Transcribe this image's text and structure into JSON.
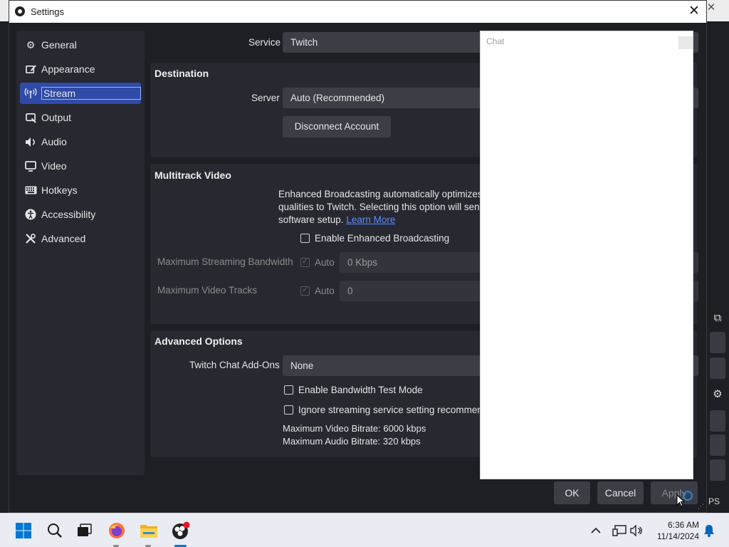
{
  "window": {
    "title": "Settings"
  },
  "sidebar": {
    "items": [
      {
        "label": "General",
        "icon": "gear-icon"
      },
      {
        "label": "Appearance",
        "icon": "brush-icon"
      },
      {
        "label": "Stream",
        "icon": "broadcast-icon",
        "active": true
      },
      {
        "label": "Output",
        "icon": "output-icon"
      },
      {
        "label": "Audio",
        "icon": "speaker-icon"
      },
      {
        "label": "Video",
        "icon": "monitor-icon"
      },
      {
        "label": "Hotkeys",
        "icon": "keyboard-icon"
      },
      {
        "label": "Accessibility",
        "icon": "accessibility-icon"
      },
      {
        "label": "Advanced",
        "icon": "tools-icon"
      }
    ]
  },
  "service": {
    "label": "Service",
    "value": "Twitch"
  },
  "destination": {
    "heading": "Destination",
    "server_label": "Server",
    "server_value": "Auto (Recommended)",
    "disconnect_label": "Disconnect Account"
  },
  "multitrack": {
    "heading": "Multitrack Video",
    "description_line1": "Enhanced Broadcasting automatically optimizes",
    "description_line2": "qualities to Twitch. Selecting this option will sen",
    "description_line3": "software setup.",
    "learn_more": "Learn More",
    "enable_label": "Enable Enhanced Broadcasting",
    "bandwidth_label": "Maximum Streaming Bandwidth",
    "bandwidth_auto": "Auto",
    "bandwidth_value": "0 Kbps",
    "tracks_label": "Maximum Video Tracks",
    "tracks_auto": "Auto",
    "tracks_value": "0"
  },
  "advanced_options": {
    "heading": "Advanced Options",
    "addons_label": "Twitch Chat Add-Ons",
    "addons_value": "None",
    "bandwidth_test_label": "Enable Bandwidth Test Mode",
    "ignore_label": "Ignore streaming service setting recommen",
    "max_video_bitrate": "Maximum Video Bitrate: 6000 kbps",
    "max_audio_bitrate": "Maximum Audio Bitrate: 320 kbps"
  },
  "chat_popup": {
    "title": "Chat"
  },
  "buttons": {
    "ok": "OK",
    "cancel": "Cancel",
    "apply": "Apply"
  },
  "background": {
    "ps_text": "PS"
  },
  "taskbar": {
    "time": "6:36 AM",
    "date": "11/14/2024"
  },
  "colors": {
    "accent": "#2f4ba6",
    "link": "#5b8cff",
    "windows_blue": "#0078d4"
  }
}
